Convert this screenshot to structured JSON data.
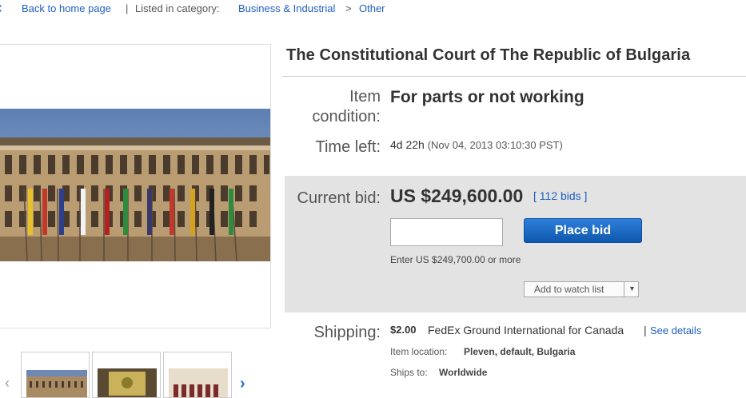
{
  "breadcrumb": {
    "back_label": "Back to home page",
    "divider": "|",
    "listed_label": "Listed in category:",
    "category": "Business & Industrial",
    "separator": ">",
    "subcategory": "Other"
  },
  "gallery": {
    "thumbnail_count": 3
  },
  "item": {
    "title": "The Constitutional Court of The Republic of Bulgaria",
    "condition_label_1": "Item",
    "condition_label_2": "condition:",
    "condition_value": "For parts or not working",
    "time_left_label": "Time left:",
    "time_left_value": "4d 22h",
    "end_date": "(Nov 04, 2013  03:10:30 PST)"
  },
  "bid": {
    "label": "Current bid:",
    "amount": "US $249,600.00",
    "bids_link": "[ 112 bids ]",
    "input_value": "",
    "place_bid_label": "Place bid",
    "note": "Enter US $249,700.00 or more",
    "watch_label": "Add to watch list"
  },
  "shipping": {
    "label": "Shipping:",
    "price": "$2.00",
    "method": "FedEx Ground International for Canada",
    "divider": "|",
    "details_link": "See details",
    "location_label": "Item location:",
    "location_value": "Pleven, default, Bulgaria",
    "ships_to_label": "Ships to:",
    "ships_to_value": "Worldwide"
  },
  "colors": {
    "link": "#1f5fbf",
    "button": "#0f57ae",
    "panel": "#e3e3e3"
  }
}
